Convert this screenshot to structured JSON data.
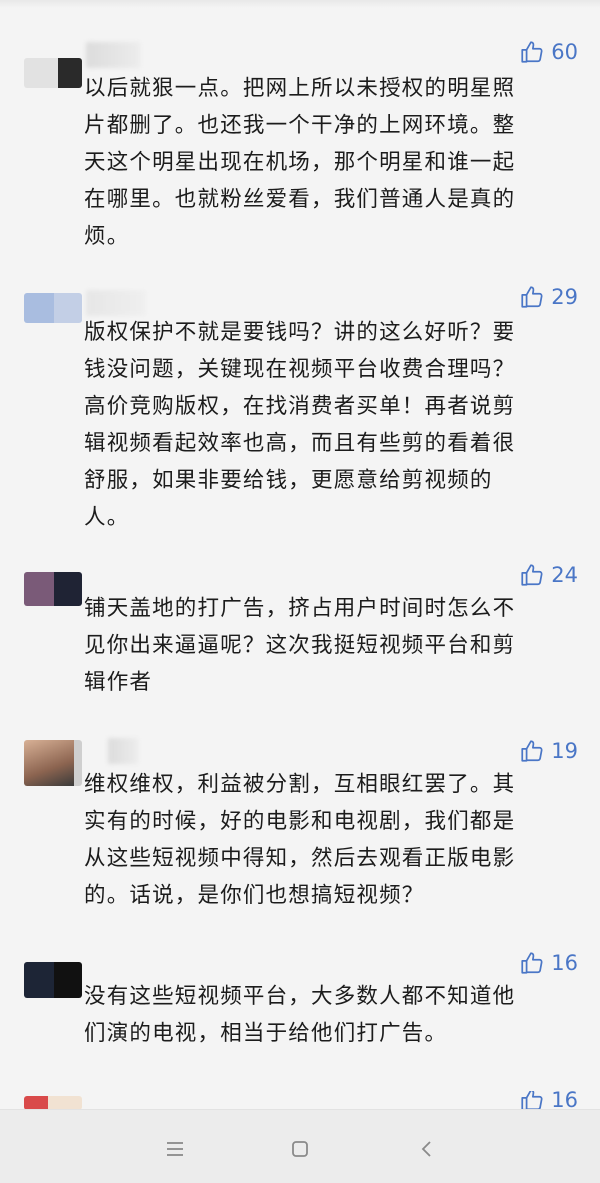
{
  "comments": [
    {
      "likes": "60",
      "avatar_colors": [
        "#e2e2e2",
        "#2a2a2a"
      ],
      "lines": [
        "以后就狠一点。把网上所以未授权的明星照",
        "片都删了。也还我一个干净的上网环境。整",
        "天这个明星出现在机场，那个明星和谁一起",
        "在哪里。也就粉丝爱看，我们普通人是真的",
        "烦。"
      ]
    },
    {
      "likes": "29",
      "avatar_colors": [
        "#a9bde0",
        "#c3cfe6"
      ],
      "lines": [
        "版权保护不就是要钱吗？讲的这么好听？要",
        "钱没问题，关键现在视频平台收费合理吗？",
        "高价竞购版权，在找消费者买单！再者说剪",
        "辑视频看起效率也高，而且有些剪的看着很",
        "舒服，如果非要给钱，更愿意给剪视频的",
        "人。"
      ]
    },
    {
      "likes": "24",
      "avatar_colors": [
        "#7a5a78",
        "#1f2334"
      ],
      "lines": [
        "铺天盖地的打广告，挤占用户时间时怎么不",
        "见你出来逼逼呢？这次我挺短视频平台和剪",
        "辑作者"
      ]
    },
    {
      "likes": "19",
      "avatar_colors": [
        "#c89a7e",
        "#cfcfcf"
      ],
      "lines": [
        "维权维权，利益被分割，互相眼红罢了。其",
        "实有的时候，好的电影和电视剧，我们都是",
        "从这些短视频中得知，然后去观看正版电影",
        "的。话说，是你们也想搞短视频？"
      ]
    },
    {
      "likes": "16",
      "avatar_colors": [
        "#1d2536",
        "#111111"
      ],
      "lines": [
        "没有这些短视频平台，大多数人都不知道他",
        "们演的电视，相当于给他们打广告。"
      ]
    },
    {
      "likes": "16",
      "avatar_colors": [
        "#d94a4a",
        "#f1e2d2"
      ],
      "lines": []
    }
  ],
  "colors": {
    "like_blue": "#4a76c6",
    "text": "#1c1c1c",
    "background": "#f4f4f4",
    "nav_bar": "#ececec"
  },
  "icons": {
    "like": "thumbs-up-icon",
    "menu": "menu-icon",
    "home": "home-square-icon",
    "back": "back-chevron-icon"
  }
}
